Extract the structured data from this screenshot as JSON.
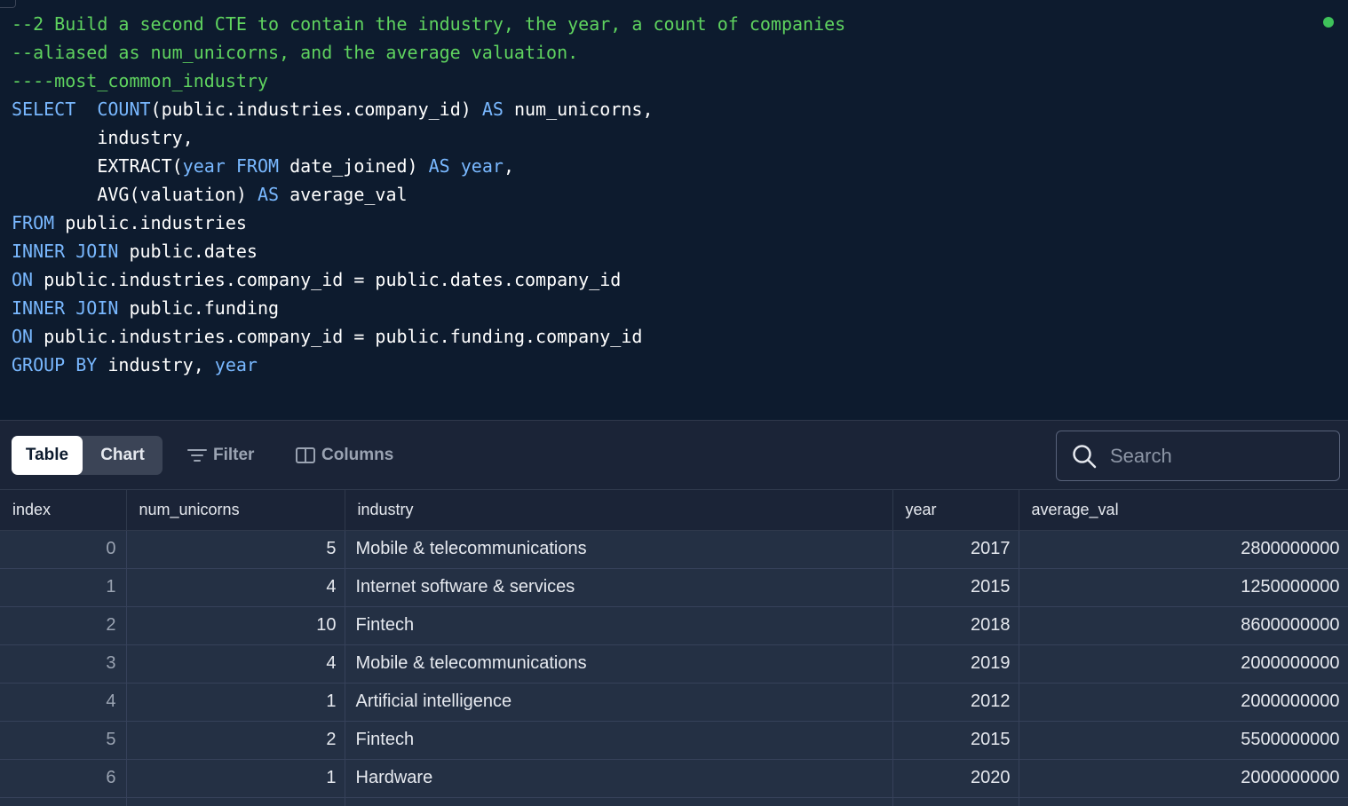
{
  "editor": {
    "lines": [
      [
        {
          "t": "--2 Build a second CTE to contain the industry, the year, a count of companies",
          "c": "comment"
        }
      ],
      [
        {
          "t": "--aliased as num_unicorns, and the average valuation.",
          "c": "comment"
        }
      ],
      [
        {
          "t": "----most_common_industry",
          "c": "comment"
        }
      ],
      [
        {
          "t": "SELECT  ",
          "c": "kw"
        },
        {
          "t": "COUNT",
          "c": "kw"
        },
        {
          "t": "(public.industries.company_id) ",
          "c": "plain"
        },
        {
          "t": "AS",
          "c": "kw"
        },
        {
          "t": " num_unicorns,",
          "c": "plain"
        }
      ],
      [
        {
          "t": "        industry,",
          "c": "plain"
        }
      ],
      [
        {
          "t": "        EXTRACT(",
          "c": "plain"
        },
        {
          "t": "year",
          "c": "kw"
        },
        {
          "t": " ",
          "c": "plain"
        },
        {
          "t": "FROM",
          "c": "kw"
        },
        {
          "t": " date_joined) ",
          "c": "plain"
        },
        {
          "t": "AS",
          "c": "kw"
        },
        {
          "t": " ",
          "c": "plain"
        },
        {
          "t": "year",
          "c": "kw"
        },
        {
          "t": ",",
          "c": "plain"
        }
      ],
      [
        {
          "t": "        AVG(valuation) ",
          "c": "plain"
        },
        {
          "t": "AS",
          "c": "kw"
        },
        {
          "t": " average_val",
          "c": "plain"
        }
      ],
      [
        {
          "t": "FROM",
          "c": "kw"
        },
        {
          "t": " public.industries",
          "c": "plain"
        }
      ],
      [
        {
          "t": "INNER JOIN",
          "c": "kw"
        },
        {
          "t": " public.dates",
          "c": "plain"
        }
      ],
      [
        {
          "t": "ON",
          "c": "kw"
        },
        {
          "t": " public.industries.company_id = public.dates.company_id",
          "c": "plain"
        }
      ],
      [
        {
          "t": "INNER JOIN",
          "c": "kw"
        },
        {
          "t": " public.funding",
          "c": "plain"
        }
      ],
      [
        {
          "t": "ON",
          "c": "kw"
        },
        {
          "t": " public.industries.company_id = public.funding.company_id",
          "c": "plain"
        }
      ],
      [
        {
          "t": "GROUP BY",
          "c": "kw"
        },
        {
          "t": " industry, ",
          "c": "plain"
        },
        {
          "t": "year",
          "c": "kw"
        }
      ]
    ]
  },
  "toolbar": {
    "table_label": "Table",
    "chart_label": "Chart",
    "filter_label": "Filter",
    "columns_label": "Columns",
    "search_placeholder": "Search"
  },
  "table": {
    "columns": [
      "index",
      "num_unicorns",
      "industry",
      "year",
      "average_val"
    ],
    "rows": [
      [
        "0",
        "5",
        "Mobile & telecommunications",
        "2017",
        "2800000000"
      ],
      [
        "1",
        "4",
        "Internet software & services",
        "2015",
        "1250000000"
      ],
      [
        "2",
        "10",
        "Fintech",
        "2018",
        "8600000000"
      ],
      [
        "3",
        "4",
        "Mobile & telecommunications",
        "2019",
        "2000000000"
      ],
      [
        "4",
        "1",
        "Artificial intelligence",
        "2012",
        "2000000000"
      ],
      [
        "5",
        "2",
        "Fintech",
        "2015",
        "5500000000"
      ],
      [
        "6",
        "1",
        "Hardware",
        "2020",
        "2000000000"
      ],
      [
        "",
        "",
        "",
        "",
        ""
      ]
    ]
  }
}
